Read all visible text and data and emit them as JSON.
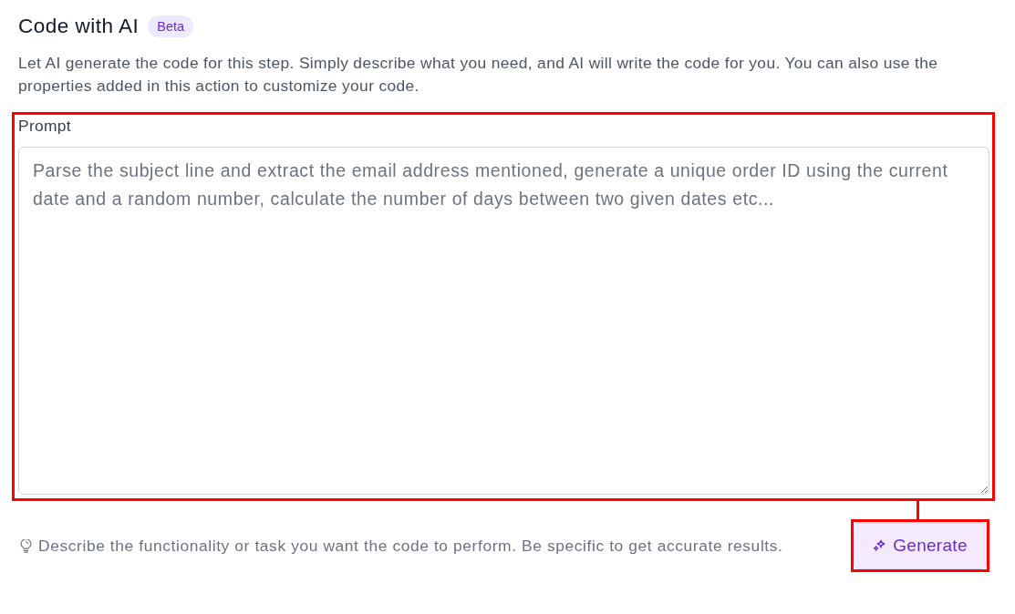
{
  "header": {
    "title": "Code with AI",
    "badge": "Beta",
    "description": "Let AI generate the code for this step. Simply describe what you need, and AI will write the code for you. You can also use the properties added in this action to customize your code."
  },
  "prompt": {
    "label": "Prompt",
    "placeholder": "Parse the subject line and extract the email address mentioned, generate a unique order ID using the current date and a random number, calculate the number of days between two given dates etc...",
    "highlighted": true
  },
  "hint": {
    "text": "Describe the functionality or task you want the code to perform. Be specific to get accurate results."
  },
  "generate_button": {
    "label": "Generate",
    "highlighted": true
  }
}
